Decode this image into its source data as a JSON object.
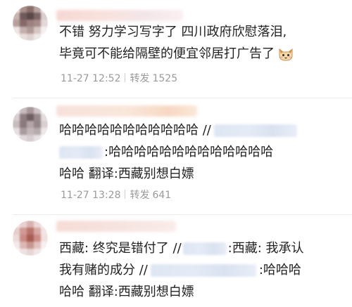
{
  "comments": [
    {
      "text_line1": "不错 努力学习写字了 四川政府欣慰落泪,",
      "text_line2": "毕竟可不能给隔壁的便宜邻居打广告了",
      "time": "11-27 12:52",
      "repost_label": "转发",
      "repost_count": "1525",
      "emoji": "cat-face-emoji"
    },
    {
      "text_line1": "哈哈哈哈哈哈哈哈哈哈哈 //",
      "text_line2": ":哈哈哈哈哈哈哈哈哈哈哈哈哈",
      "text_line3": "哈哈 翻译:西藏别想白嫖",
      "time": "11-27 13:28",
      "repost_label": "转发",
      "repost_count": "641"
    },
    {
      "line1_a": "西藏: 终究是错付了 //",
      "line1_b": ":西藏: 我承认",
      "line2_a": "我有赌的成分 //",
      "line2_b": ":哈哈哈",
      "line3": "哈哈 翻译:西藏别想白嫖"
    }
  ],
  "colors": {
    "text": "#222222",
    "meta": "#9a9a9a",
    "redaction_blue": "#dde6f3",
    "name_blur_pink": "#f6d8d4"
  }
}
